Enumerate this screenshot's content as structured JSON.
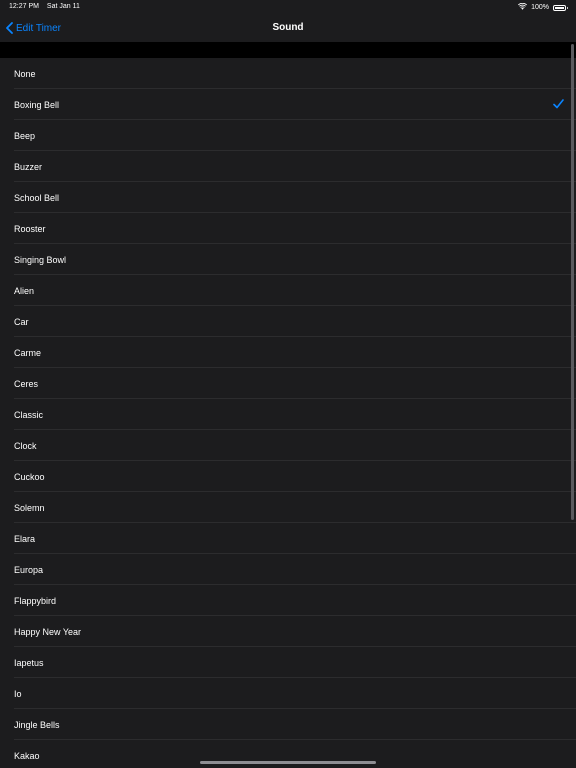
{
  "status": {
    "time": "12:27 PM",
    "date": "Sat Jan 11",
    "battery": "100%",
    "battery_level": 1.0
  },
  "nav": {
    "back_label": "Edit Timer",
    "title": "Sound"
  },
  "accent_color": "#0a84ff",
  "selected_index": 1,
  "sounds": [
    "None",
    "Boxing Bell",
    "Beep",
    "Buzzer",
    "School Bell",
    "Rooster",
    "Singing Bowl",
    "Alien",
    "Car",
    "Carme",
    "Ceres",
    "Classic",
    "Clock",
    "Cuckoo",
    "Solemn",
    "Elara",
    "Europa",
    "Flappybird",
    "Happy New Year",
    "Iapetus",
    "Io",
    "Jingle Bells",
    "Kakao"
  ]
}
